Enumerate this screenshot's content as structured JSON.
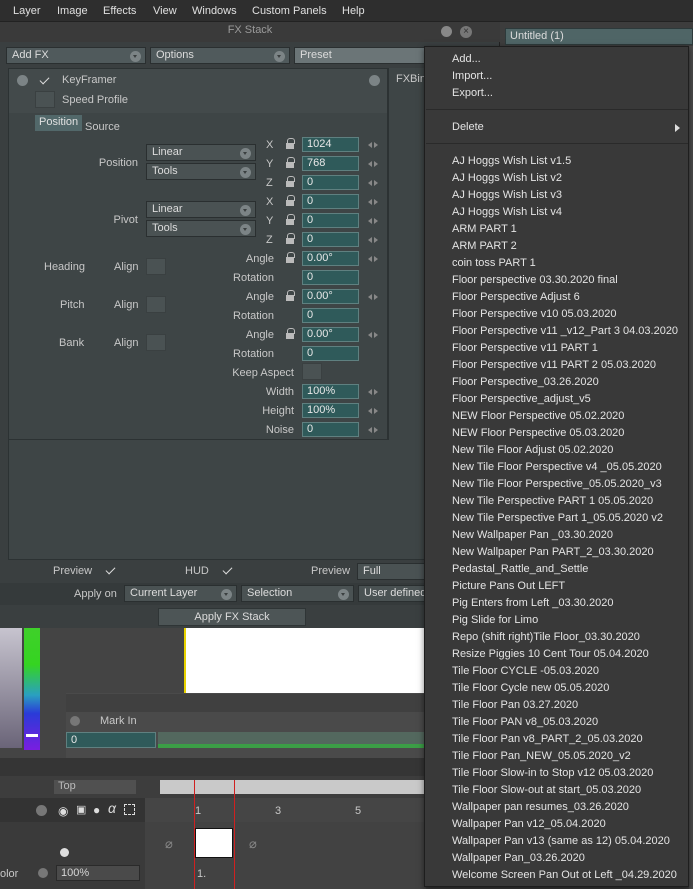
{
  "menubar": {
    "items": [
      "Layer",
      "Image",
      "Effects",
      "View",
      "Windows",
      "Custom Panels",
      "Help"
    ]
  },
  "fx_stack": {
    "title": "FX Stack",
    "add_fx": "Add FX",
    "options": "Options",
    "preset": "Preset",
    "untitled_tab": "Untitled (1)",
    "effect_name": "KeyFramer",
    "speed_profile": "Speed Profile",
    "right_col_label": "FXBin",
    "tabs": [
      "Position",
      "Source"
    ],
    "position_label": "Position",
    "pivot_label": "Pivot",
    "interp_linear": "Linear",
    "interp_tools": "Tools",
    "axis": [
      "X",
      "Y",
      "Z"
    ],
    "position_values": [
      "1024",
      "768",
      "0"
    ],
    "pivot_values": [
      "0",
      "0",
      "0"
    ],
    "heading": "Heading",
    "pitch": "Pitch",
    "bank": "Bank",
    "align": "Align",
    "angle": "Angle",
    "rotation": "Rotation",
    "heading_angle": "0.00°",
    "heading_rotation": "0",
    "pitch_angle": "0.00°",
    "pitch_rotation": "0",
    "bank_angle": "0.00°",
    "bank_rotation": "0",
    "keep_aspect": "Keep Aspect",
    "width_label": "Width",
    "width_value": "100%",
    "height_label": "Height",
    "height_value": "100%",
    "noise_label": "Noise",
    "noise_value": "0",
    "preview_label": "Preview",
    "hud_label": "HUD",
    "preview2_label": "Preview",
    "preview2_value": "Full",
    "apply_on_label": "Apply on",
    "apply_on_value": "Current Layer",
    "selection_value": "Selection",
    "user_defined_value": "User defined",
    "apply_button": "Apply FX Stack"
  },
  "preset_menu": {
    "top_items": [
      "Add...",
      "Import...",
      "Export..."
    ],
    "delete": "Delete",
    "presets": [
      "AJ Hoggs Wish List v1.5",
      "AJ Hoggs Wish List v2",
      "AJ Hoggs Wish List v3",
      "AJ Hoggs Wish List v4",
      "ARM PART 1",
      "ARM PART 2",
      "coin toss PART  1",
      "Floor perspective 03.30.2020 final",
      "Floor Perspective Adjust 6",
      "Floor Perspective v10 05.03.2020",
      "Floor Perspective v11 _v12_Part 3 04.03.2020",
      "Floor Perspective v11 PART 1",
      "Floor Perspective v11 PART 2 05.03.2020",
      "Floor Perspective_03.26.2020",
      "Floor Perspective_adjust_v5",
      "NEW Floor Perspective 05.02.2020",
      "NEW Floor Perspective 05.03.2020",
      "New Tile Floor Adjust 05.02.2020",
      "New Tile Floor Perspective v4 _05.05.2020",
      "New Tile Floor Perspective_05.05.2020_v3",
      "New Tile Perspective PART 1 05.05.2020",
      "New Tile Perspective Part 1_05.05.2020 v2",
      "New Wallpaper Pan _03.30.2020",
      "New Wallpaper Pan PART_2_03.30.2020",
      "Pedastal_Rattle_and_Settle",
      "Picture Pans Out LEFT",
      "Pig Enters from Left _03.30.2020",
      "Pig Slide for Limo",
      "Repo  (shift right)Tile Floor_03.30.2020",
      "Resize Piggies 10 Cent Tour 05.04.2020",
      "Tile Floor CYCLE -05.03.2020",
      "Tile Floor Cycle new 05.05.2020",
      "Tile Floor Pan 03.27.2020",
      "Tile Floor PAN v8_05.03.2020",
      "Tile Floor Pan v8_PART_2_05.03.2020",
      "Tile Floor Pan_NEW_05.05.2020_v2",
      "Tile Floor Slow-in to Stop v12 05.03.2020",
      "Tile Floor Slow-out at start_05.03.2020",
      "Wallpaper pan resumes_03.26.2020",
      "Wallpaper Pan v12_05.04.2020",
      "Wallpaper Pan v13 (same as 12) 05.04.2020",
      "Wallpaper Pan_03.26.2020",
      "Welcome Screen Pan Out ot Left _04.29.2020"
    ]
  },
  "timeline": {
    "mark_in": "Mark In",
    "mark_value": "0",
    "top_label": "Top",
    "frame_ticks": [
      "1",
      "3",
      "5"
    ],
    "frame_label": "1.",
    "opacity_value": "100%",
    "olor_label": "olor"
  },
  "colors": {
    "accent_green": "#35d421",
    "field_teal": "#2f5a5a",
    "menu_bg": "#393939"
  }
}
